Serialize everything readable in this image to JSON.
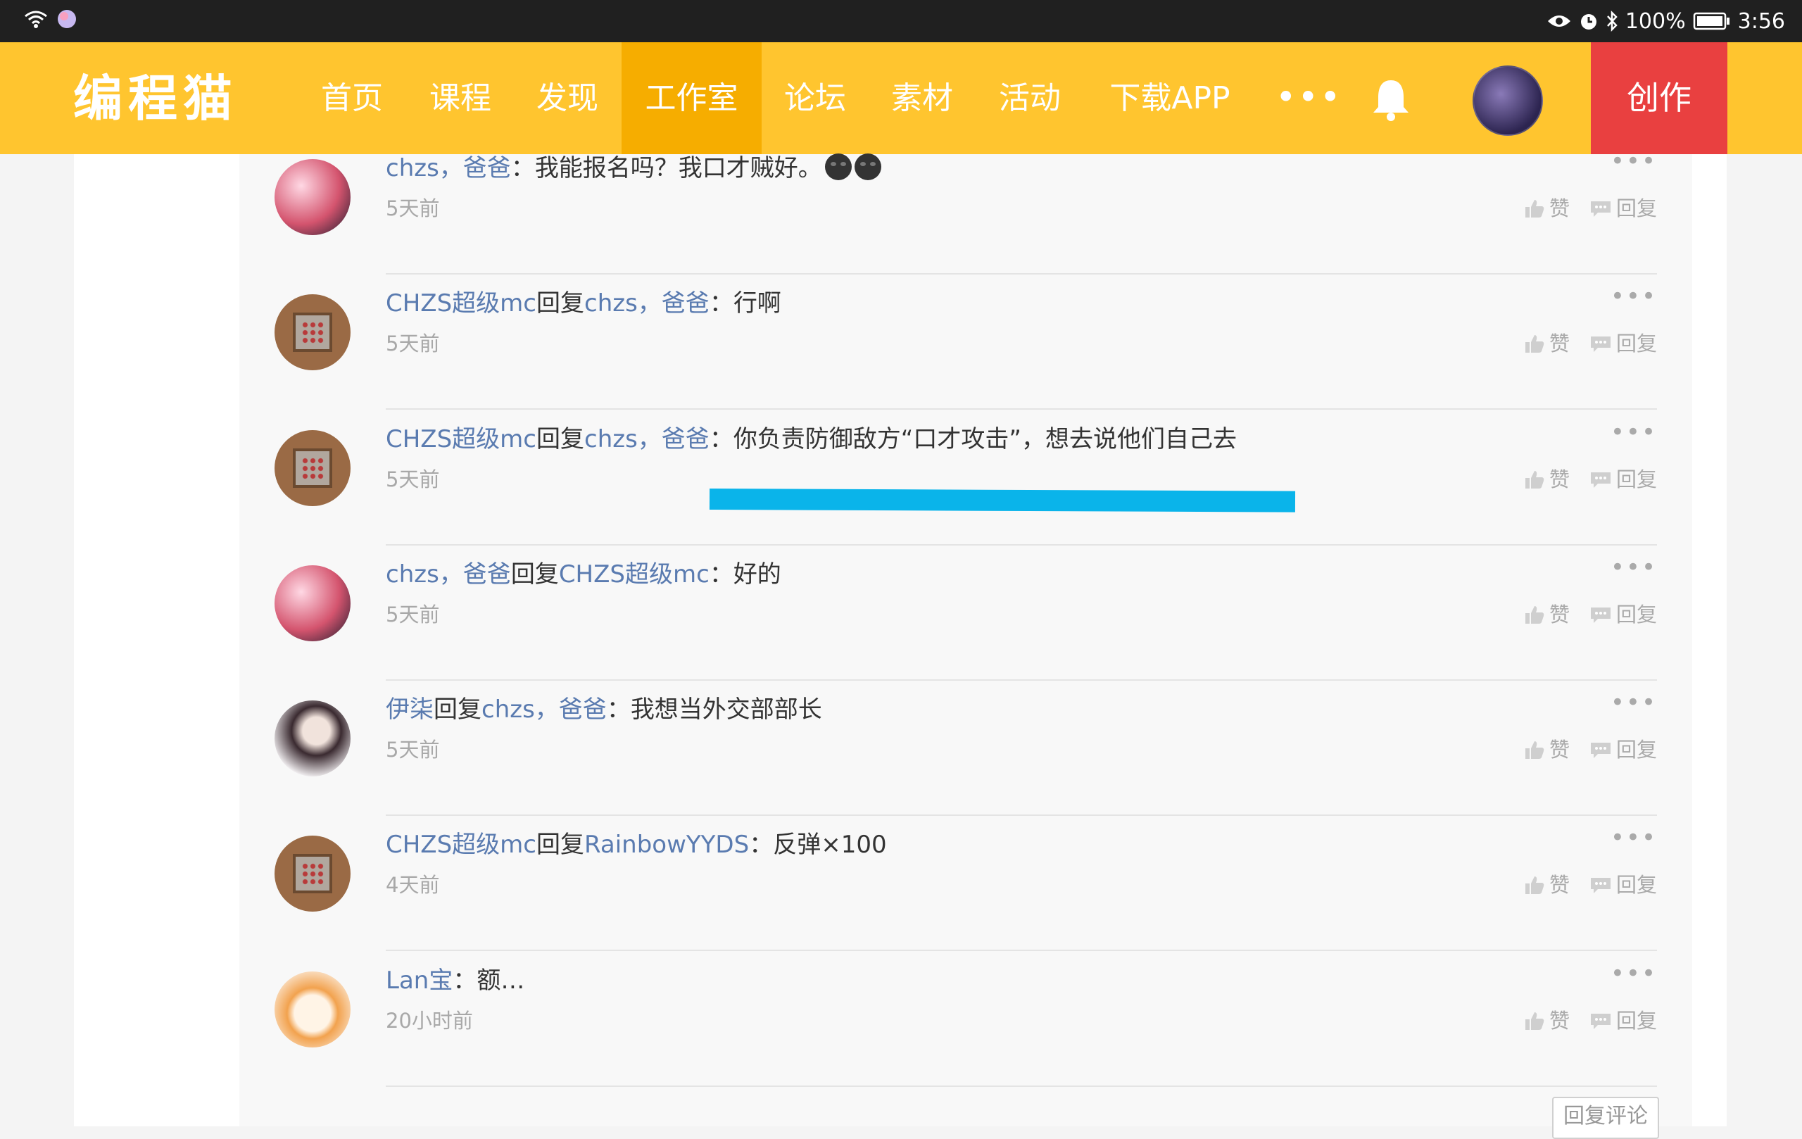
{
  "status_bar": {
    "battery": "100%",
    "time": "3:56"
  },
  "nav": {
    "logo": "编程猫",
    "items": [
      "首页",
      "课程",
      "发现",
      "工作室",
      "论坛",
      "素材",
      "活动",
      "下载APP"
    ],
    "active_index": 3,
    "more": "•••",
    "create_label": "创作",
    "colors": {
      "bar": "#ffc52f",
      "active": "#f6ad00",
      "create": "#e94040"
    }
  },
  "comments": [
    {
      "author": "chzs，爸爸",
      "reply_to": "",
      "sep": "：",
      "text": "我能报名吗？我口才贼好。",
      "time": "5天前",
      "emoji_count": 2
    },
    {
      "author": "CHZS超级mc",
      "reply_word": "回复",
      "reply_to": "chzs，爸爸",
      "sep": "：",
      "text": "行啊",
      "time": "5天前"
    },
    {
      "author": "CHZS超级mc",
      "reply_word": "回复",
      "reply_to": "chzs，爸爸",
      "sep": "：",
      "text": "你负责防御敌方“口才攻击”，想去说他们自己去",
      "time": "5天前"
    },
    {
      "author": "chzs，爸爸",
      "reply_word": "回复",
      "reply_to": "CHZS超级mc",
      "sep": "：",
      "text": "好的",
      "time": "5天前"
    },
    {
      "author": "伊柒",
      "reply_word": "回复",
      "reply_to": "chzs，爸爸",
      "sep": "：",
      "text": "我想当外交部部长",
      "time": "5天前"
    },
    {
      "author": "CHZS超级mc",
      "reply_word": "回复",
      "reply_to": "RainbowYYDS",
      "sep": "：",
      "text": "反弹×100",
      "time": "4天前"
    },
    {
      "author": "Lan宝",
      "reply_to": "",
      "sep": "：",
      "text": "额…",
      "time": "20小时前"
    }
  ],
  "actions": {
    "like": "赞",
    "reply": "回复",
    "more": "•••"
  },
  "reply_comment_button": "回复评论",
  "colors": {
    "name": "#5a7bb0",
    "highlight": "#0ab4ea"
  }
}
